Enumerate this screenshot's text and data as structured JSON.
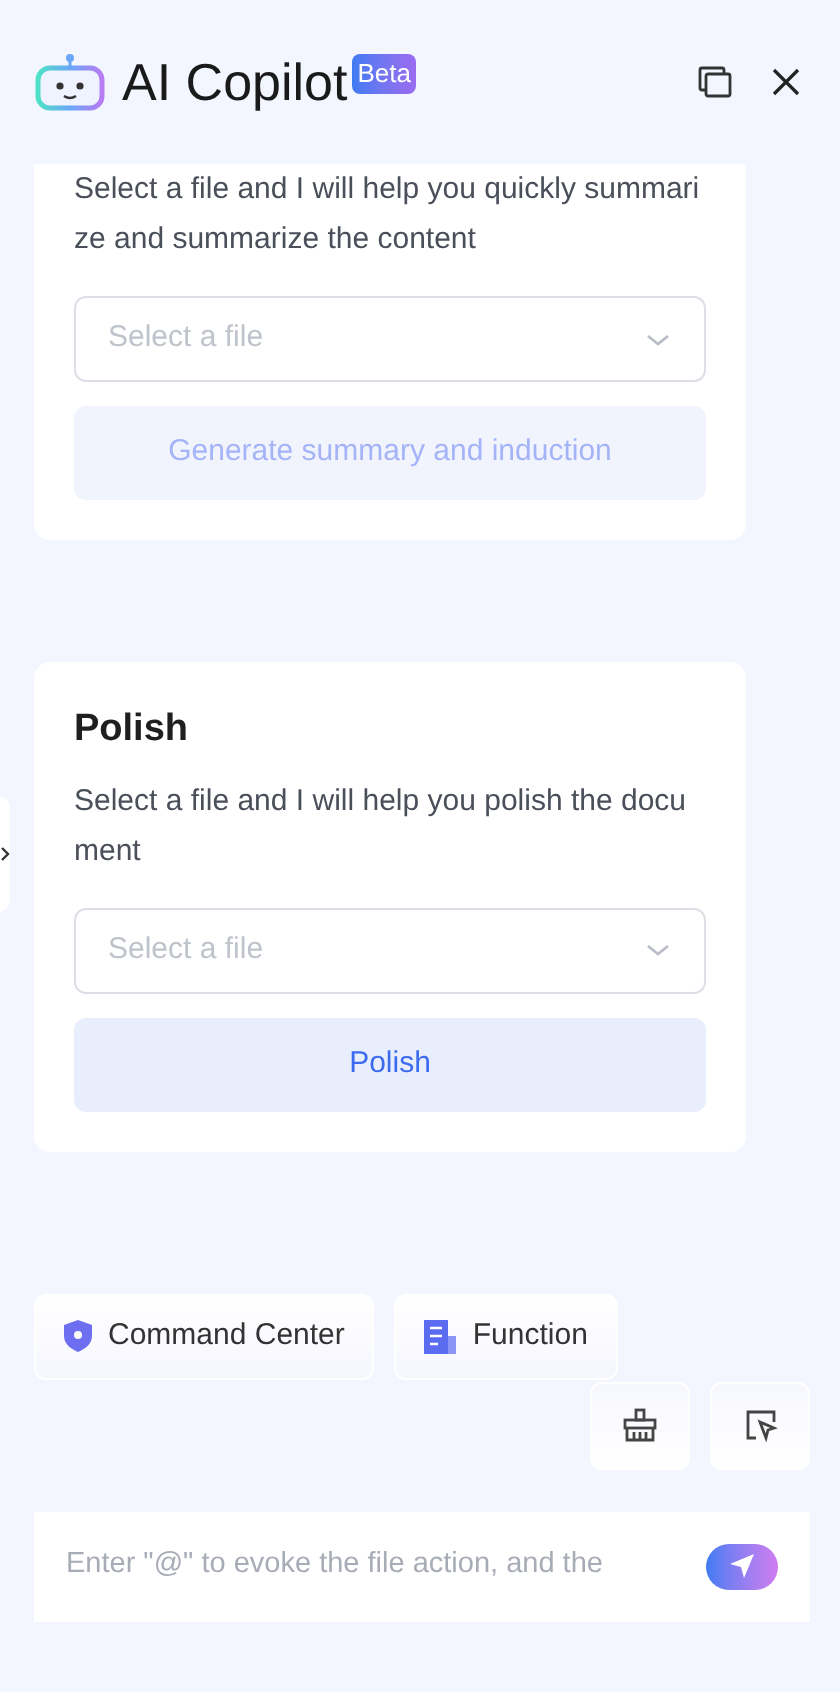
{
  "header": {
    "title": "AI Copilot",
    "badge": "Beta"
  },
  "cards": [
    {
      "description": "Select a file and I will help you quickly summarize and summarize the content",
      "select": {
        "placeholder": "Select a file"
      },
      "button": {
        "label": "Generate summary and induction",
        "disabled": true
      }
    },
    {
      "title": "Polish",
      "description": "Select a file and I will help you polish the document",
      "select": {
        "placeholder": "Select a file"
      },
      "button": {
        "label": "Polish",
        "disabled": false
      }
    }
  ],
  "chips": [
    {
      "kind": "shield",
      "label": "Command Center"
    },
    {
      "kind": "doc",
      "label": "Function"
    }
  ],
  "input": {
    "placeholder": "Enter \"@\" to evoke the file action, and the"
  }
}
